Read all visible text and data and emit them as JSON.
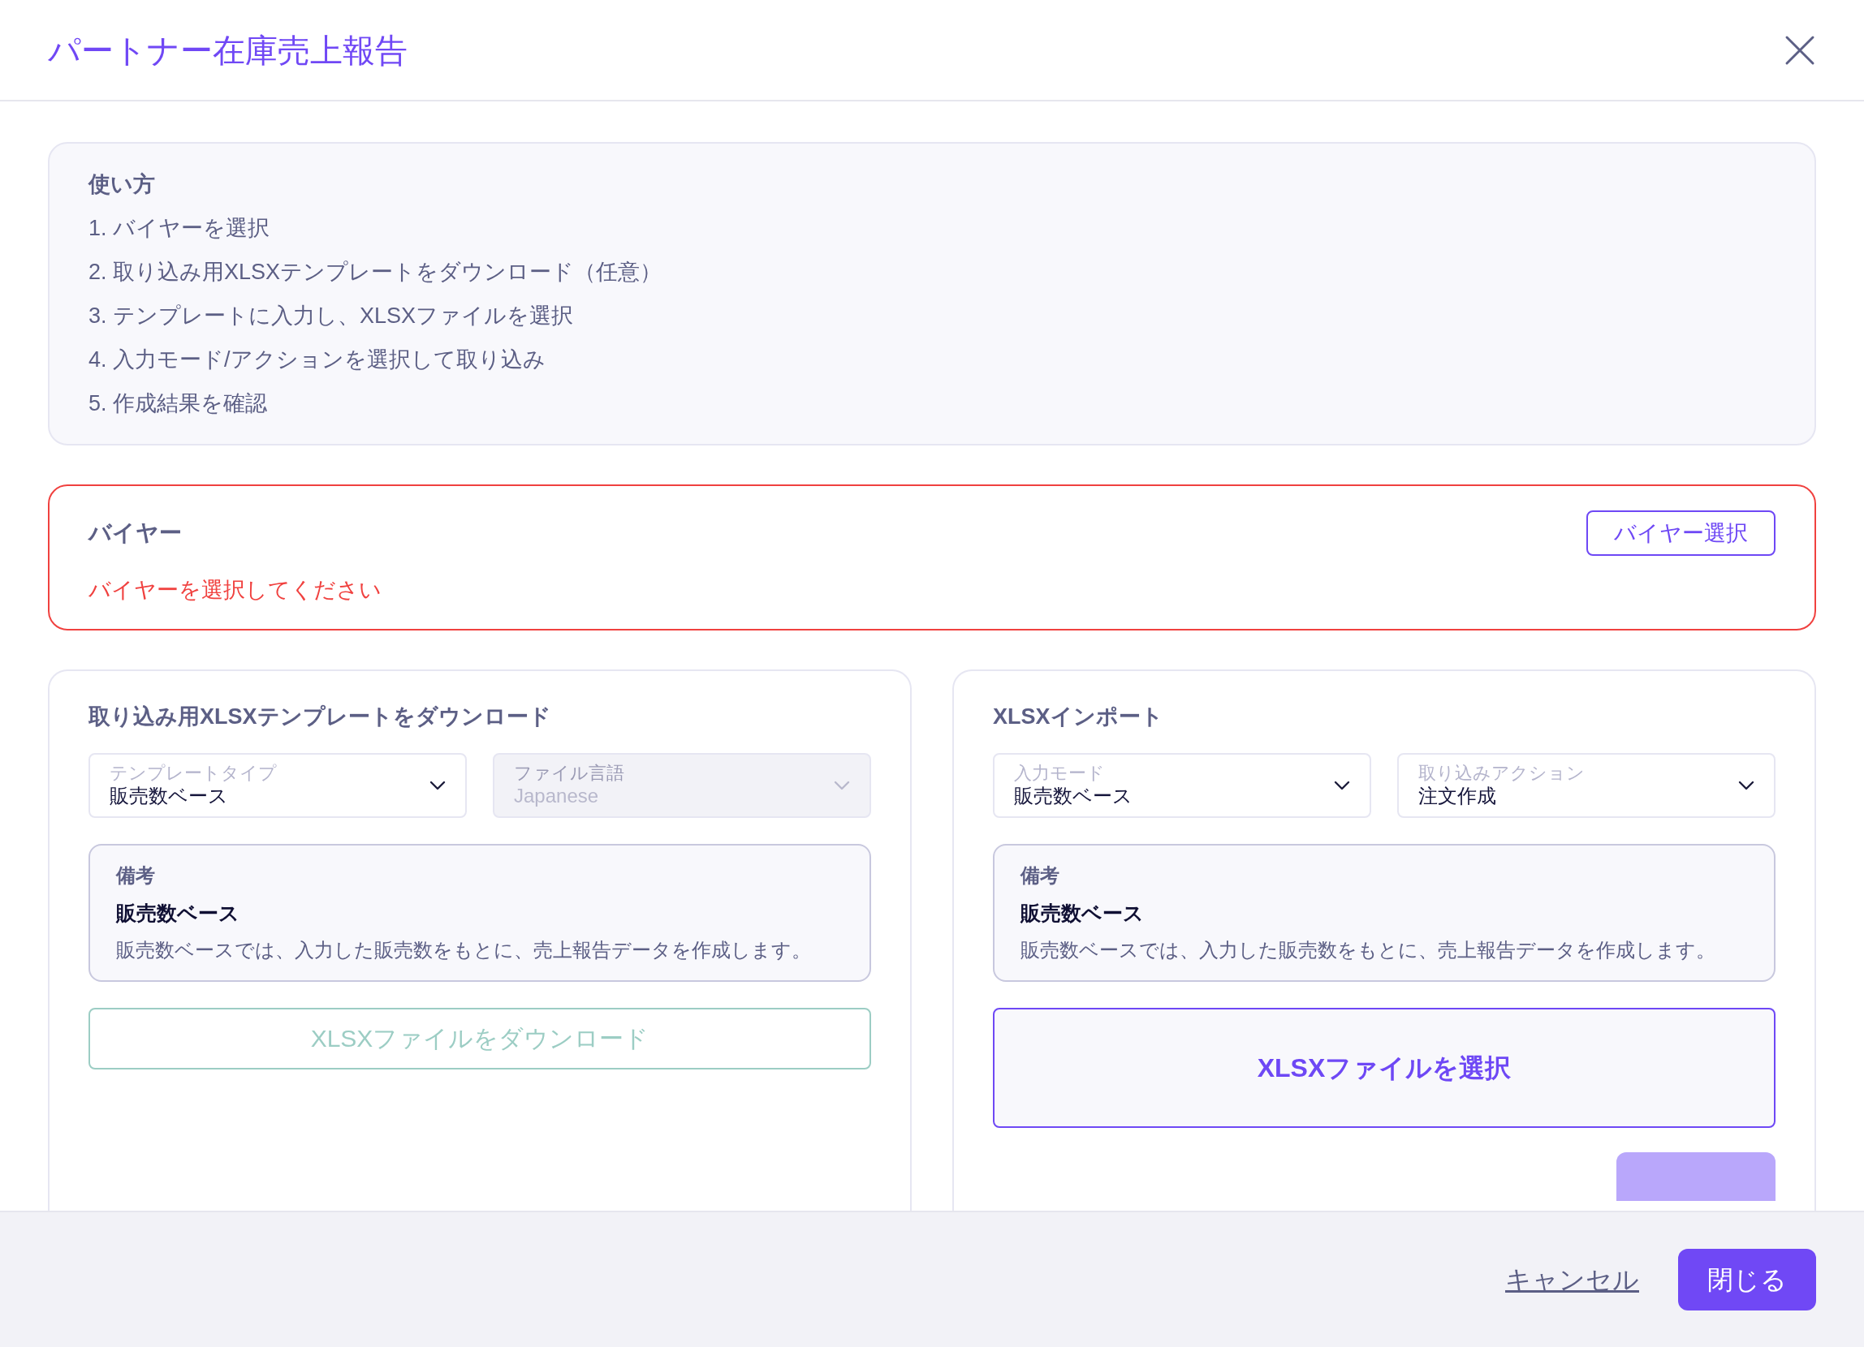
{
  "dialog": {
    "title": "パートナー在庫売上報告"
  },
  "instructions": {
    "heading": "使い方",
    "steps": [
      "1. バイヤーを選択",
      "2. 取り込み用XLSXテンプレートをダウンロード（任意）",
      "3. テンプレートに入力し、XLSXファイルを選択",
      "4. 入力モード/アクションを選択して取り込み",
      "5. 作成結果を確認"
    ]
  },
  "buyer": {
    "heading": "バイヤー",
    "button": "バイヤー選択",
    "error": "バイヤーを選択してください"
  },
  "download_panel": {
    "heading": "取り込み用XLSXテンプレートをダウンロード",
    "selects": [
      {
        "label": "テンプレートタイプ",
        "value": "販売数ベース",
        "disabled": false
      },
      {
        "label": "ファイル言語",
        "value": "Japanese",
        "disabled": true
      }
    ],
    "note": {
      "heading": "備考",
      "title": "販売数ベース",
      "text": "販売数ベースでは、入力した販売数をもとに、売上報告データを作成します。"
    },
    "button": {
      "label": "XLSXファイルをダウンロード",
      "disabled": true
    }
  },
  "import_panel": {
    "heading": "XLSXインポート",
    "selects": [
      {
        "label": "入力モード",
        "value": "販売数ベース",
        "disabled": false
      },
      {
        "label": "取り込みアクション",
        "value": "注文作成",
        "disabled": false
      }
    ],
    "note": {
      "heading": "備考",
      "title": "販売数ベース",
      "text": "販売数ベースでは、入力した販売数をもとに、売上報告データを作成します。"
    },
    "file_button": "XLSXファイルを選択",
    "import_button": {
      "disabled": true
    }
  },
  "footer": {
    "cancel": "キャンセル",
    "close": "閉じる"
  }
}
